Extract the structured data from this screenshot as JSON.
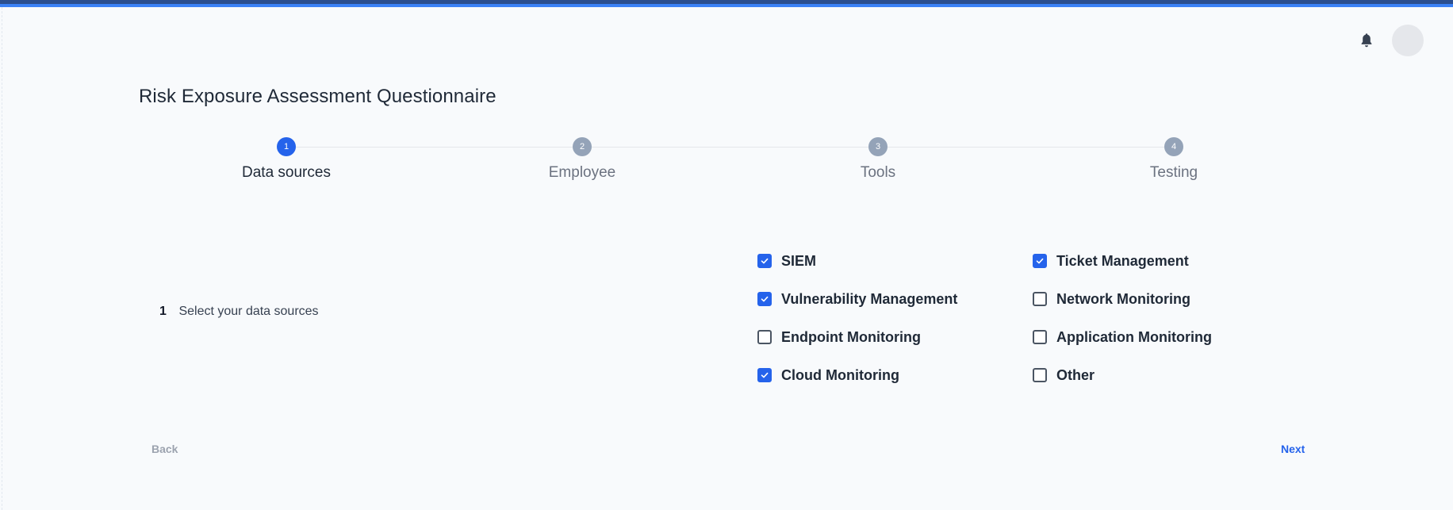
{
  "header": {
    "notifications_icon": "bell-icon",
    "avatar_icon": "user-avatar"
  },
  "page": {
    "title": "Risk Exposure Assessment Questionnaire"
  },
  "stepper": {
    "current_step": 1,
    "steps": [
      {
        "number": "1",
        "label": "Data sources",
        "active": true
      },
      {
        "number": "2",
        "label": "Employee",
        "active": false
      },
      {
        "number": "3",
        "label": "Tools",
        "active": false
      },
      {
        "number": "4",
        "label": "Testing",
        "active": false
      }
    ]
  },
  "question": {
    "number": "1",
    "text": "Select your data sources",
    "options": [
      {
        "label": "SIEM",
        "checked": true
      },
      {
        "label": "Ticket Management",
        "checked": true
      },
      {
        "label": "Vulnerability Management",
        "checked": true
      },
      {
        "label": "Network Monitoring",
        "checked": false
      },
      {
        "label": "Endpoint Monitoring",
        "checked": false
      },
      {
        "label": "Application Monitoring",
        "checked": false
      },
      {
        "label": "Cloud Monitoring",
        "checked": true
      },
      {
        "label": "Other",
        "checked": false
      }
    ]
  },
  "footer": {
    "back_label": "Back",
    "next_label": "Next"
  },
  "colors": {
    "accent": "#2563eb",
    "top_bar": "#2b4f8f",
    "inactive_step": "#94a3b8",
    "background": "#f8fafc"
  }
}
